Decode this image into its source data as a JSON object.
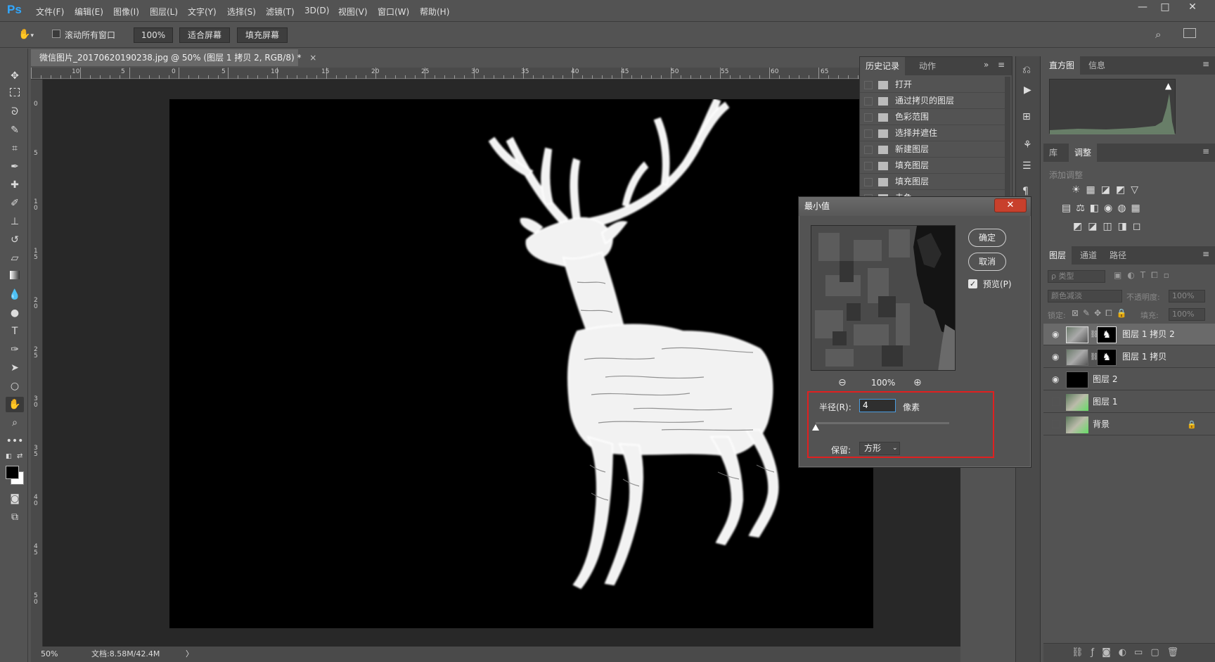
{
  "app": {
    "logo": "Ps",
    "menus": [
      "文件(F)",
      "编辑(E)",
      "图像(I)",
      "图层(L)",
      "文字(Y)",
      "选择(S)",
      "滤镜(T)",
      "3D(D)",
      "视图(V)",
      "窗口(W)",
      "帮助(H)"
    ],
    "window_controls": {
      "minimize": "—",
      "maximize": "□",
      "close": "✕"
    }
  },
  "options_bar": {
    "tool_icon": "hand-icon",
    "scroll_all_label": "滚动所有窗口",
    "scroll_all_checked": false,
    "zoom_value": "100%",
    "fit_screen_label": "适合屏幕",
    "fill_screen_label": "填充屏幕"
  },
  "document": {
    "tab_title": "微信图片_20170620190238.jpg @ 50% (图层 1 拷贝 2, RGB/8) *",
    "tab_close": "×",
    "ruler_top_labels": [
      "10",
      "5",
      "0",
      "5",
      "10",
      "15",
      "20",
      "25",
      "30",
      "35",
      "40",
      "45",
      "50",
      "55",
      "60",
      "65"
    ],
    "ruler_left_labels": [
      "0",
      "5",
      "10",
      "15",
      "20",
      "25",
      "30",
      "35",
      "40",
      "45",
      "50"
    ],
    "status_zoom": "50%",
    "status_doc": "文档:8.58M/42.4M",
    "status_arrow": "〉"
  },
  "history_panel": {
    "tabs": [
      "历史记录",
      "动作"
    ],
    "active_tab": 0,
    "items": [
      "打开",
      "通过拷贝的图层",
      "色彩范围",
      "选择并遮住",
      "新建图层",
      "填充图层",
      "填充图层",
      "去色"
    ]
  },
  "histogram_panel": {
    "tabs": [
      "直方图",
      "信息"
    ],
    "active_tab": 0,
    "warning_icon": "warning-icon"
  },
  "adjustments_panel": {
    "tabs": [
      "库",
      "调整"
    ],
    "active_tab": 1,
    "heading": "添加调整"
  },
  "layers_panel": {
    "tabs": [
      "图层",
      "通道",
      "路径"
    ],
    "active_tab": 0,
    "filter_label": "ρ 类型",
    "blend_mode": "颜色减淡",
    "opacity_label": "不透明度:",
    "opacity_value": "100%",
    "lock_label": "锁定:",
    "fill_label": "填充:",
    "fill_value": "100%",
    "layers": [
      {
        "name": "图层 1 拷贝 2",
        "visible": true,
        "selected": true,
        "has_mask": true,
        "thumb": "photo",
        "locked": false
      },
      {
        "name": "图层 1 拷贝",
        "visible": true,
        "selected": false,
        "has_mask": true,
        "thumb": "photo",
        "locked": false
      },
      {
        "name": "图层 2",
        "visible": true,
        "selected": false,
        "has_mask": false,
        "thumb": "black",
        "locked": false
      },
      {
        "name": "图层 1",
        "visible": false,
        "selected": false,
        "has_mask": false,
        "thumb": "photo",
        "locked": false
      },
      {
        "name": "背景",
        "visible": false,
        "selected": false,
        "has_mask": false,
        "thumb": "photo",
        "locked": true
      }
    ]
  },
  "dialog": {
    "title": "最小值",
    "close": "✕",
    "ok_label": "确定",
    "cancel_label": "取消",
    "preview_label": "预览(P)",
    "preview_checked": true,
    "zoom_value": "100%",
    "radius_label": "半径(R):",
    "radius_value": "4",
    "radius_unit": "像素",
    "preserve_label": "保留:",
    "preserve_value": "方形"
  },
  "colors": {
    "ui_bg": "#535353",
    "panel_dark": "#424242",
    "accent_blue": "#31a8ff",
    "highlight_red": "#e02020"
  }
}
